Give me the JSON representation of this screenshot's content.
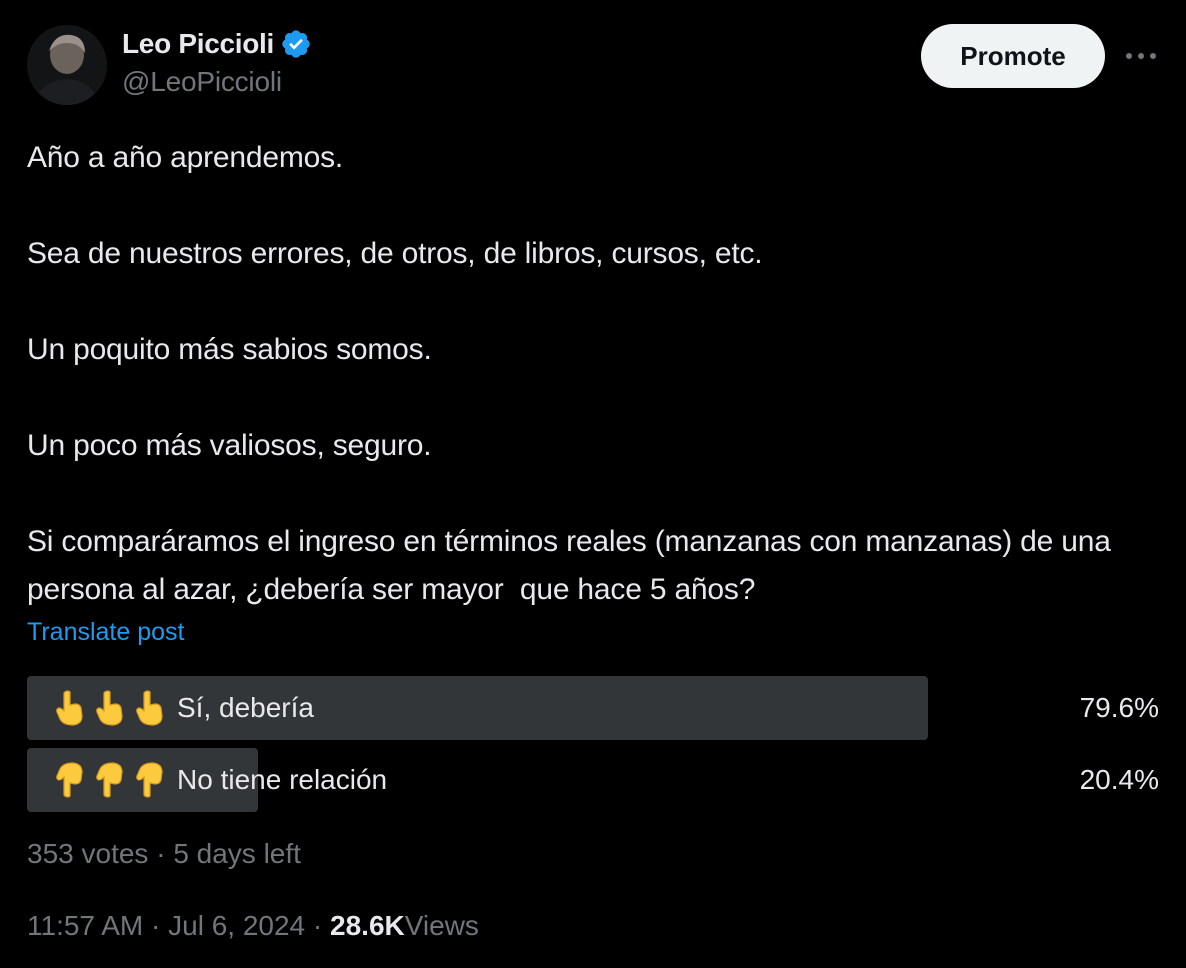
{
  "author": {
    "display_name": "Leo Piccioli",
    "handle": "@LeoPiccioli",
    "verified": true
  },
  "actions": {
    "promote_label": "Promote",
    "more_icon": "more-horizontal-icon"
  },
  "tweet": {
    "paragraphs": [
      "Año a año aprendemos.",
      "Sea de nuestros errores, de otros, de libros, cursos, etc.",
      "Un poquito más sabios somos.",
      "Un poco más valiosos, seguro.",
      "Si comparáramos el ingreso en términos reales (manzanas con manzanas) de una persona al azar, ¿debería ser mayor  que hace 5 años?"
    ],
    "translate_label": "Translate post"
  },
  "poll": {
    "options": [
      {
        "label": "Sí, debería",
        "percent": "79.6%",
        "fraction": 0.796,
        "emoji": "pointing-up-hand-icon"
      },
      {
        "label": "No tiene relación",
        "percent": "20.4%",
        "fraction": 0.204,
        "emoji": "pointing-down-hand-icon"
      }
    ],
    "votes": "353 votes",
    "time_left": "5 days left"
  },
  "meta": {
    "time": "11:57 AM",
    "date": "Jul 6, 2024",
    "views_count": "28.6K",
    "views_label": "Views"
  },
  "colors": {
    "background": "#000000",
    "text_primary": "#e7e9ea",
    "text_secondary": "#71767b",
    "accent_blue": "#1d9bf0",
    "poll_bar": "#333639",
    "promote_bg": "#eff3f4",
    "emoji_yellow": "#fccb3d"
  }
}
